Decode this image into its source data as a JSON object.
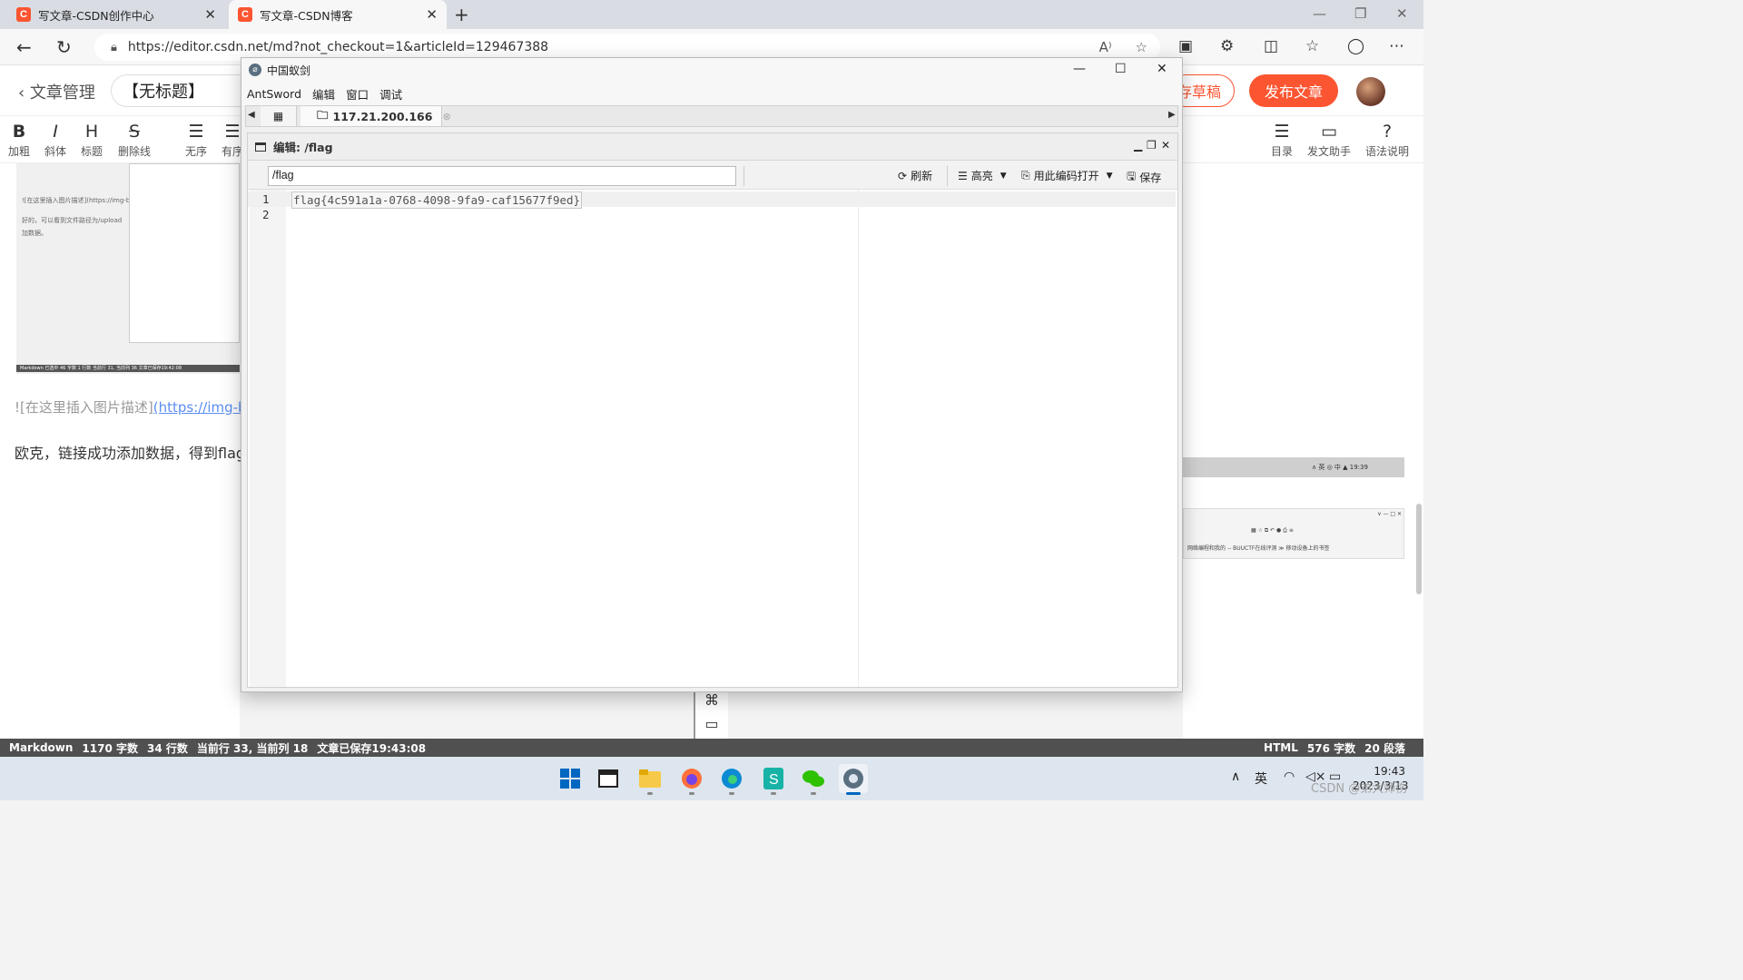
{
  "browser": {
    "tabs": [
      {
        "title": "写文章-CSDN创作中心",
        "favicon": "C"
      },
      {
        "title": "写文章-CSDN博客",
        "favicon": "C"
      }
    ],
    "url": "https://editor.csdn.net/md?not_checkout=1&articleId=129467388"
  },
  "csdn": {
    "back_label": "文章管理",
    "title_value": "【无标题】",
    "draft_label": "存草稿",
    "publish_label": "发布文章",
    "toolbar_left": [
      {
        "glyph": "B",
        "label": "加粗"
      },
      {
        "glyph": "I",
        "label": "斜体"
      },
      {
        "glyph": "H",
        "label": "标题"
      },
      {
        "glyph": "S",
        "label": "删除线"
      },
      {
        "glyph": "☰",
        "label": "无序"
      },
      {
        "glyph": "☰",
        "label": "有序"
      }
    ],
    "toolbar_right": [
      {
        "glyph": "☰",
        "label": "目录"
      },
      {
        "glyph": "▭",
        "label": "发文助手"
      },
      {
        "glyph": "?",
        "label": "语法说明"
      }
    ],
    "content": {
      "thumb_text1": "![在这里插入图片描述](https://img-b",
      "thumb_text2": "好的，可以看到文件路径为/upload",
      "thumb_text3": "加数据。",
      "thumb_status": "Markdown 已选中 46 字数 1 行数 当前行 31, 当前列 36 文章已保存19:42:08",
      "image_link_prefix": "![在这里插入图片描述]",
      "image_link_url": "(https://img-b",
      "ok_line": "欧克，链接成功添加数据，得到flag"
    },
    "right_thumb": {
      "row1": "∧ 英 ◎ 中 ▲ 19:39",
      "row2": "∨  —  □  ✕",
      "row3": "▦ ☆   ⧉ ↶ ● ⎙ ≡",
      "row4": "网络编程和我的 -- BUUCTF在线评测   ≫ 移动设备上的书签"
    },
    "statusbar": {
      "mode": "Markdown",
      "words": "1170 字数",
      "lines": "34 行数",
      "cursor": "当前行 33, 当前列 18",
      "saved": "文章已保存19:43:08",
      "html": "HTML",
      "html_words": "576 字数",
      "paragraphs": "20 段落"
    }
  },
  "antsword": {
    "window_title": "中国蚁剑",
    "menu": [
      "AntSword",
      "编辑",
      "窗口",
      "调试"
    ],
    "connection_tab": "117.21.200.166",
    "panel_title": "编辑: /flag",
    "path_value": "/flag",
    "buttons": {
      "refresh": "刷新",
      "highlight": "高亮",
      "open_with": "用此编码打开",
      "save": "保存"
    },
    "code_lines": [
      {
        "n": "1",
        "text": "flag{4c591a1a-0768-4098-9fa9-caf15677f9ed}"
      },
      {
        "n": "2",
        "text": ""
      }
    ]
  },
  "taskbar": {
    "apps": [
      "windows-start",
      "terminal",
      "file-explorer",
      "firefox",
      "edge",
      "app-s",
      "wechat",
      "antsword"
    ],
    "ime": "英",
    "time": "19:43",
    "date": "2023/3/13"
  },
  "watermark": "CSDN @弟大师伤",
  "colors": {
    "accent": "#fc5531",
    "statusbar": "#505050"
  }
}
